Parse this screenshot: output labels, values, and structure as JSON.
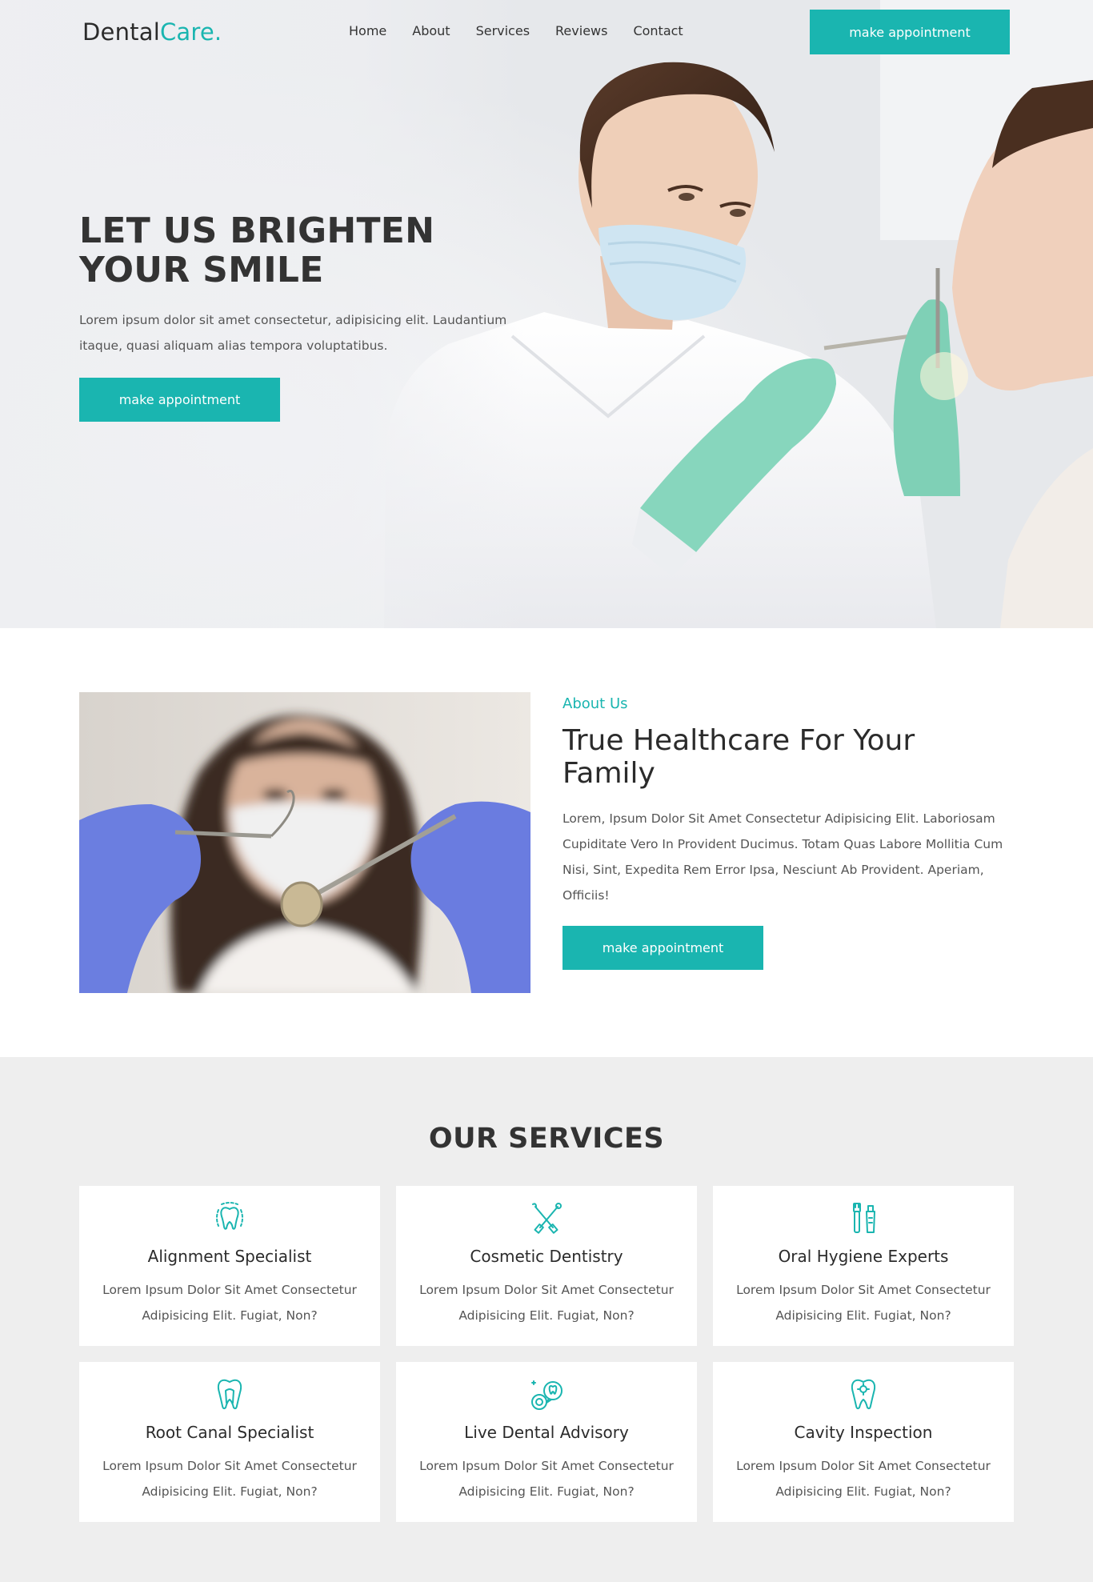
{
  "brand": {
    "name_primary": "Dental",
    "name_accent": "Care."
  },
  "nav": {
    "items": [
      "Home",
      "About",
      "Services",
      "Reviews",
      "Contact"
    ],
    "cta_label": "make appointment"
  },
  "hero": {
    "title": "LET US BRIGHTEN YOUR SMILE",
    "text": "Lorem ipsum dolor sit amet consectetur, adipisicing elit. Laudantium itaque, quasi aliquam alias tempora voluptatibus.",
    "button_label": "make appointment"
  },
  "about": {
    "eyebrow": "About Us",
    "title": "True Healthcare For Your Family",
    "body": "Lorem, Ipsum Dolor Sit Amet Consectetur Adipisicing Elit. Laboriosam Cupiditate Vero In Provident Ducimus. Totam Quas Labore Mollitia Cum Nisi, Sint, Expedita Rem Error Ipsa, Nesciunt Ab Provident. Aperiam, Officiis!",
    "button_label": "make appointment"
  },
  "services": {
    "heading": "OUR SERVICES",
    "items": [
      {
        "icon": "tooth-alignment-icon",
        "title": "Alignment Specialist",
        "desc": "Lorem Ipsum Dolor Sit Amet Consectetur Adipisicing Elit. Fugiat, Non?"
      },
      {
        "icon": "dental-tools-icon",
        "title": "Cosmetic Dentistry",
        "desc": "Lorem Ipsum Dolor Sit Amet Consectetur Adipisicing Elit. Fugiat, Non?"
      },
      {
        "icon": "toothbrush-paste-icon",
        "title": "Oral Hygiene Experts",
        "desc": "Lorem Ipsum Dolor Sit Amet Consectetur Adipisicing Elit. Fugiat, Non?"
      },
      {
        "icon": "tooth-root-icon",
        "title": "Root Canal Specialist",
        "desc": "Lorem Ipsum Dolor Sit Amet Consectetur Adipisicing Elit. Fugiat, Non?"
      },
      {
        "icon": "dental-advisory-chat-icon",
        "title": "Live Dental Advisory",
        "desc": "Lorem Ipsum Dolor Sit Amet Consectetur Adipisicing Elit. Fugiat, Non?"
      },
      {
        "icon": "tooth-inspection-icon",
        "title": "Cavity Inspection",
        "desc": "Lorem Ipsum Dolor Sit Amet Consectetur Adipisicing Elit. Fugiat, Non?"
      }
    ]
  },
  "colors": {
    "accent": "#1ab5b0",
    "text_dark": "#333333",
    "services_bg": "#eeeeee"
  }
}
